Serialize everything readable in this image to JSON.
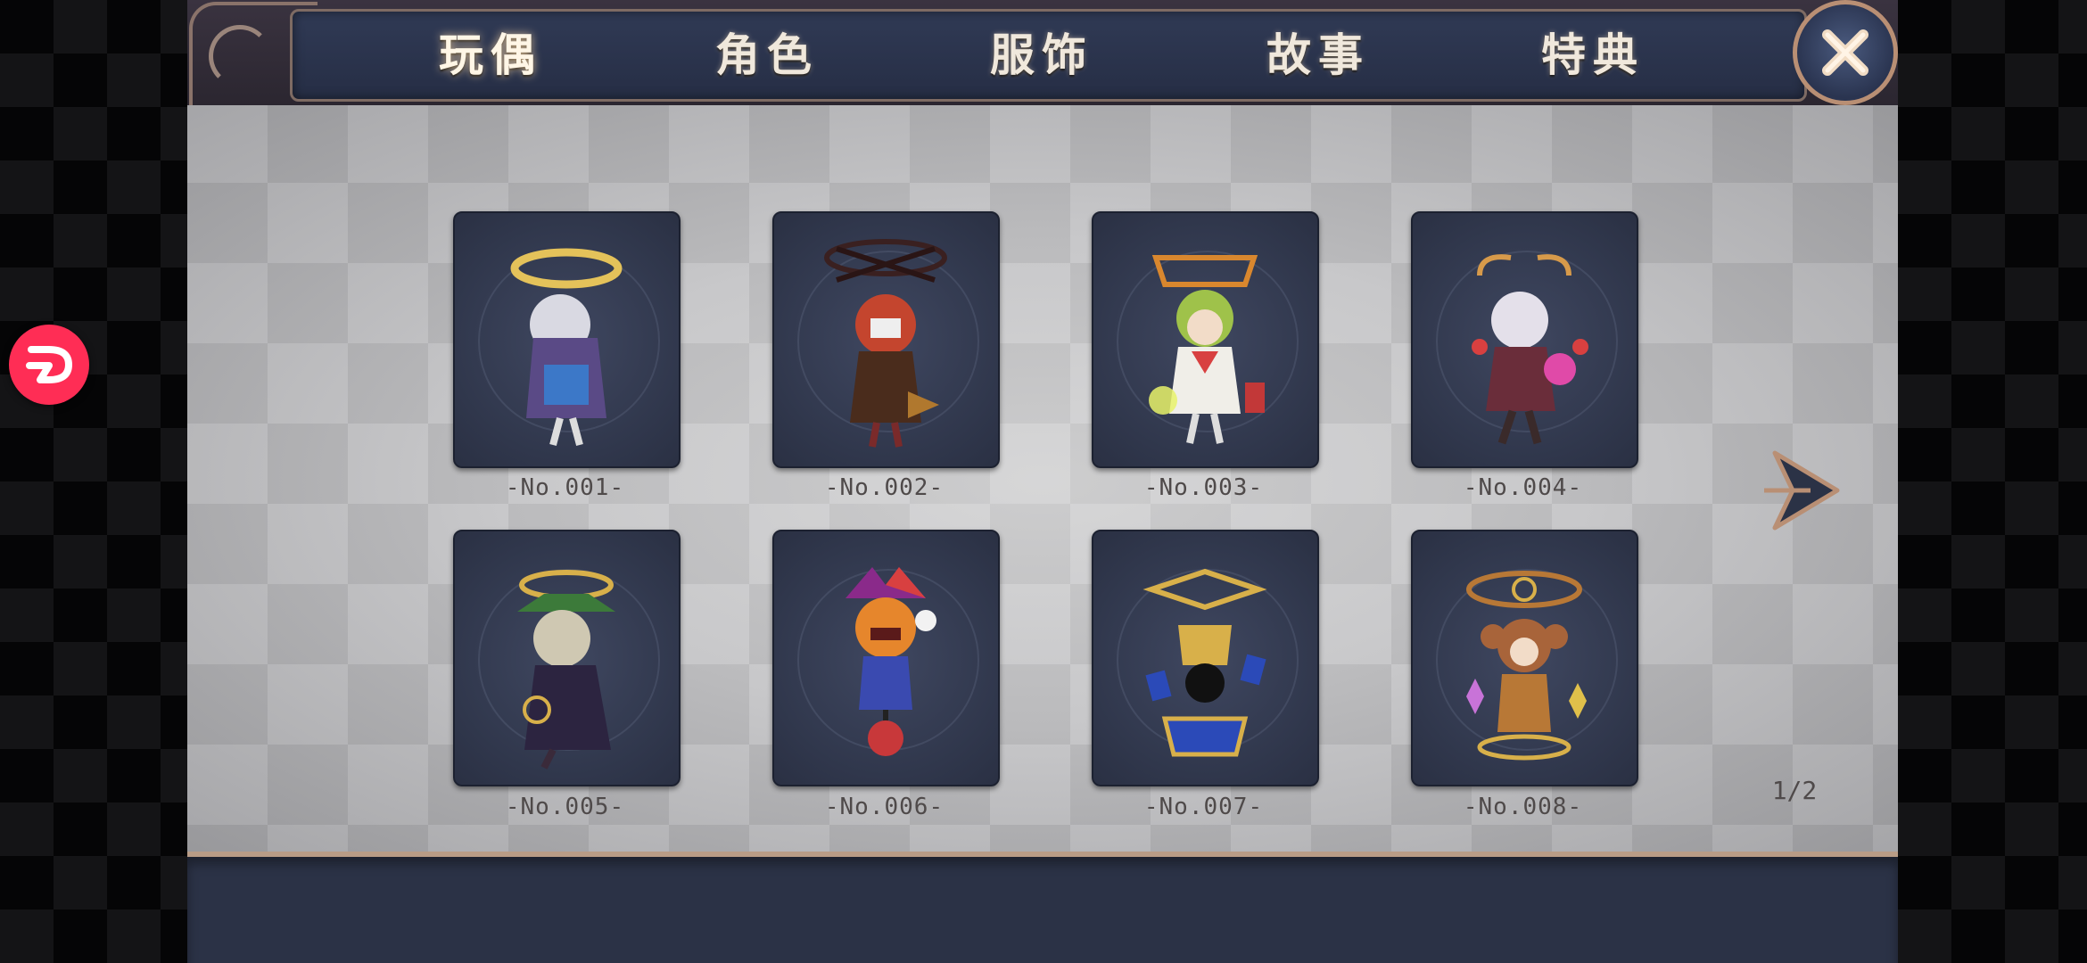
{
  "tabs": [
    {
      "label": "玩偶",
      "active": true
    },
    {
      "label": "角色",
      "active": false
    },
    {
      "label": "服饰",
      "active": false
    },
    {
      "label": "故事",
      "active": false
    },
    {
      "label": "特典",
      "active": false
    }
  ],
  "close_icon": "close-x-icon",
  "dolls": [
    {
      "label": "-No.001-",
      "accent": "#e4c25a"
    },
    {
      "label": "-No.002-",
      "accent": "#c4452e"
    },
    {
      "label": "-No.003-",
      "accent": "#9fc24a"
    },
    {
      "label": "-No.004-",
      "accent": "#d79a4a"
    },
    {
      "label": "-No.005-",
      "accent": "#8da65a"
    },
    {
      "label": "-No.006-",
      "accent": "#e6862c"
    },
    {
      "label": "-No.007-",
      "accent": "#3a63c8"
    },
    {
      "label": "-No.008-",
      "accent": "#b87836"
    }
  ],
  "pagination": {
    "text": "1/2",
    "next_icon": "next-arrow-icon"
  },
  "floating_button_icon": "app-launcher-icon"
}
